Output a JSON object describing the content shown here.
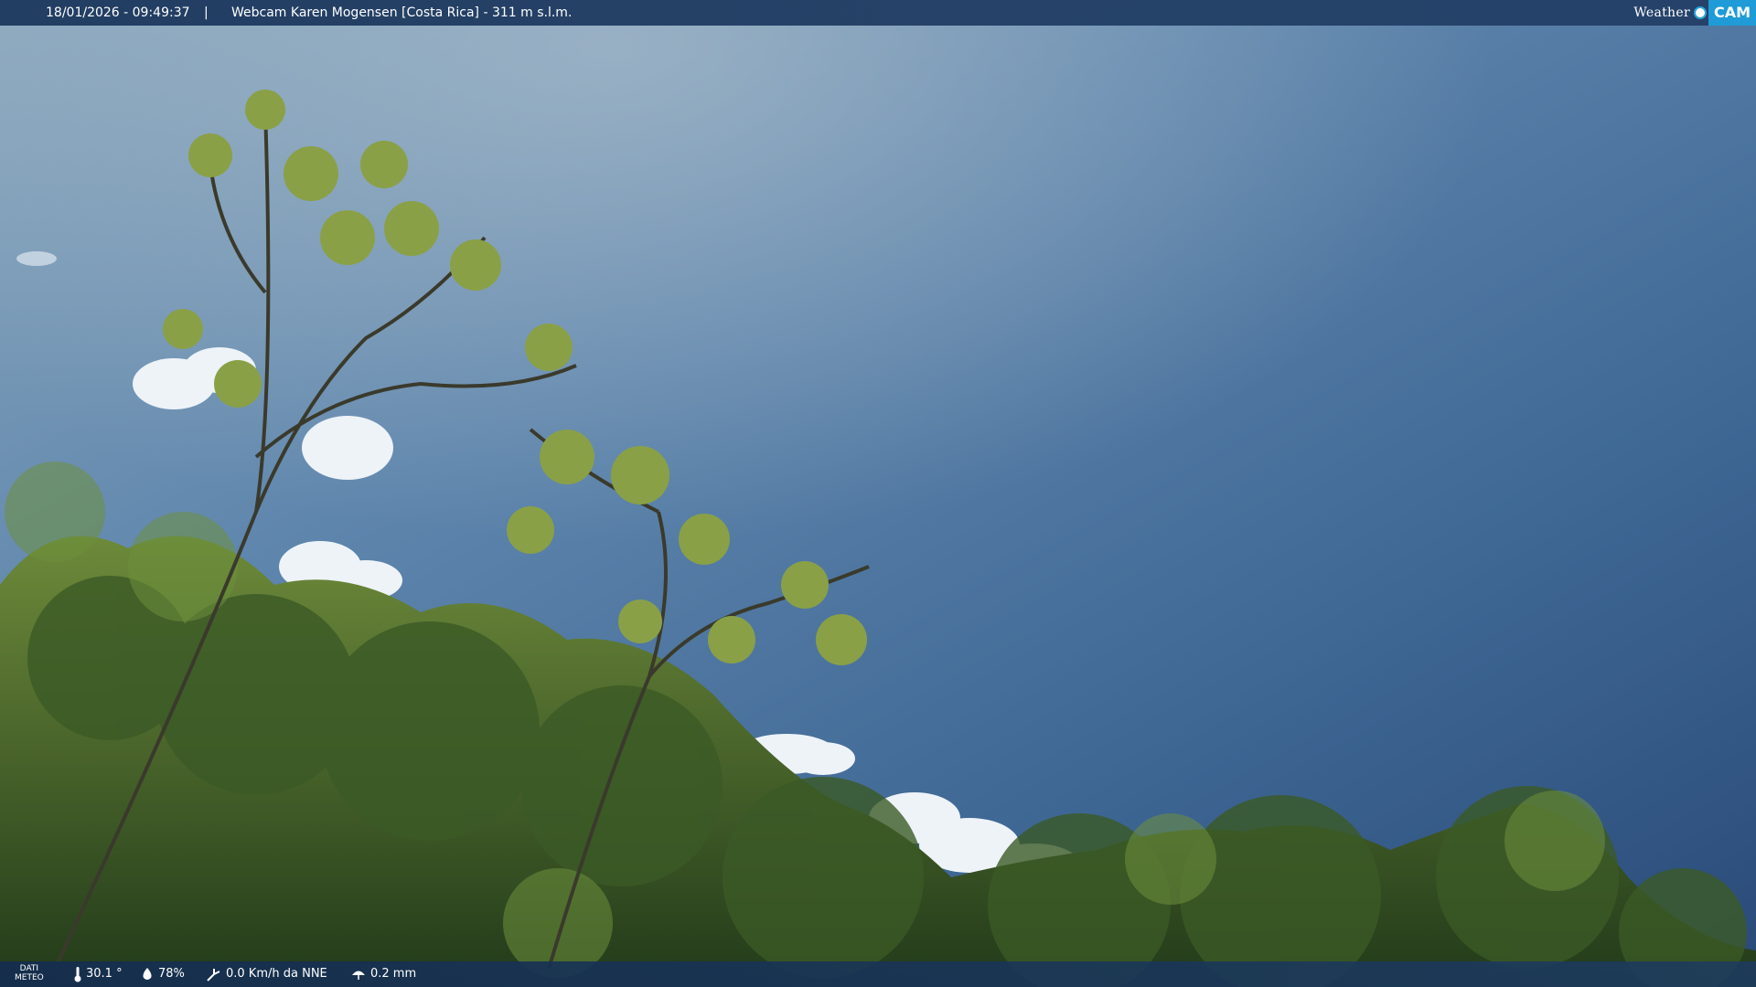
{
  "header": {
    "timestamp": "18/01/2026 - 09:49:37",
    "separator": "|",
    "title": "Webcam Karen Mogensen [Costa Rica] - 311 m s.l.m."
  },
  "logo": {
    "weather": "Weather",
    "cam": "CAM"
  },
  "footer": {
    "meteo_line1": "DATI",
    "meteo_line2": "METEO",
    "temperature": "30.1 °",
    "humidity": "78%",
    "wind": "0.0 Km/h da NNE",
    "rain": "0.2 mm"
  }
}
